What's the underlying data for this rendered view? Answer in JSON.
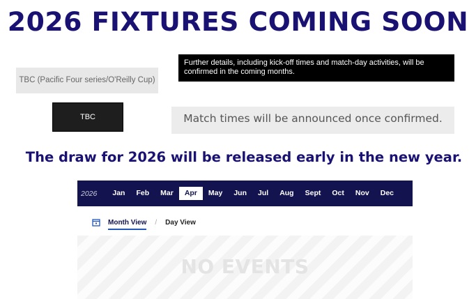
{
  "headline": "2026 FIXTURES COMING SOON",
  "tbc_note": "TBC (Pacific Four series/O'Reilly Cup)",
  "details": "Further details, including kick-off times and match-day activities, will be confirmed in the coming months.",
  "tbc_button": "TBC",
  "times_note": "Match times will be announced once confirmed.",
  "draw_note": "The draw for 2026 will be released early in the new year.",
  "calendar": {
    "year": "2026",
    "months": [
      "Jan",
      "Feb",
      "Mar",
      "Apr",
      "May",
      "Jun",
      "Jul",
      "Aug",
      "Sept",
      "Oct",
      "Nov",
      "Dec"
    ],
    "active_month": "Apr",
    "views": {
      "month": "Month View",
      "separator": "/",
      "day": "Day View"
    },
    "empty_text": "NO EVENTS",
    "colors": {
      "bar": "#13134f",
      "accent": "#2456b8"
    }
  }
}
